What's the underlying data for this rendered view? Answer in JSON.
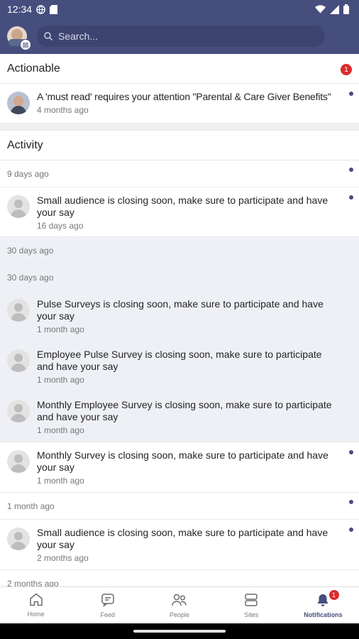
{
  "status_bar": {
    "time": "12:34"
  },
  "search": {
    "placeholder": "Search..."
  },
  "actionable": {
    "title": "Actionable",
    "count": "1",
    "items": [
      {
        "message": "A 'must read' requires your attention \"Parental & Care Giver Benefits\"",
        "time": "4 months ago"
      }
    ]
  },
  "activity": {
    "title": "Activity",
    "groups": [
      {
        "label": "9 days ago"
      },
      {
        "label": "30 days ago"
      },
      {
        "label": "30 days ago"
      },
      {
        "label": "1 month ago"
      },
      {
        "label": "2 months ago"
      }
    ],
    "items": [
      {
        "message": "Small audience is closing soon, make sure to participate and have your say",
        "time": "16 days ago"
      },
      {
        "message": "Pulse Surveys is closing soon, make sure to participate and have your say",
        "time": "1 month ago"
      },
      {
        "message": "Employee Pulse Survey is closing soon, make sure to participate and have your say",
        "time": "1 month ago"
      },
      {
        "message": "Monthly Employee Survey is closing soon, make sure to participate and have your say",
        "time": "1 month ago"
      },
      {
        "message": "Monthly Survey is closing soon, make sure to participate and have your say",
        "time": "1 month ago"
      },
      {
        "message": "Small audience is closing soon, make sure to participate and have your say",
        "time": "2 months ago"
      }
    ]
  },
  "bottom_nav": [
    {
      "label": "Home",
      "icon": "home-icon"
    },
    {
      "label": "Feed",
      "icon": "feed-icon"
    },
    {
      "label": "People",
      "icon": "people-icon"
    },
    {
      "label": "Sites",
      "icon": "sites-icon"
    },
    {
      "label": "Notifications",
      "icon": "bell-icon",
      "badge": "1",
      "active": true
    }
  ],
  "colors": {
    "brand": "#464e7e",
    "badge": "#d92c2c",
    "read_bg": "#eef0f5"
  }
}
